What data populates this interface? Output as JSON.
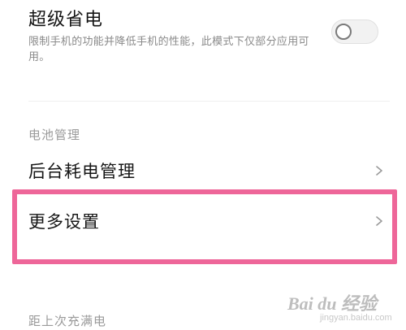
{
  "super_saver": {
    "title": "超级省电",
    "description": "限制手机的功能并降低手机的性能，此模式下仅部分应用可用。",
    "toggle_state": "off"
  },
  "battery_section": {
    "header": "电池管理",
    "items": [
      {
        "label": "后台耗电管理",
        "icon": "chevron-right-icon"
      },
      {
        "label": "更多设置",
        "icon": "chevron-right-icon"
      }
    ]
  },
  "footer": {
    "partial_text": "距上次充满电"
  },
  "watermark": {
    "text": "Bai du 经验",
    "sub": "jingyan.baidu.com"
  },
  "colors": {
    "highlight": "#ee6699",
    "secondary_text": "#8a8a8a",
    "section_header": "#9a9a9a"
  }
}
